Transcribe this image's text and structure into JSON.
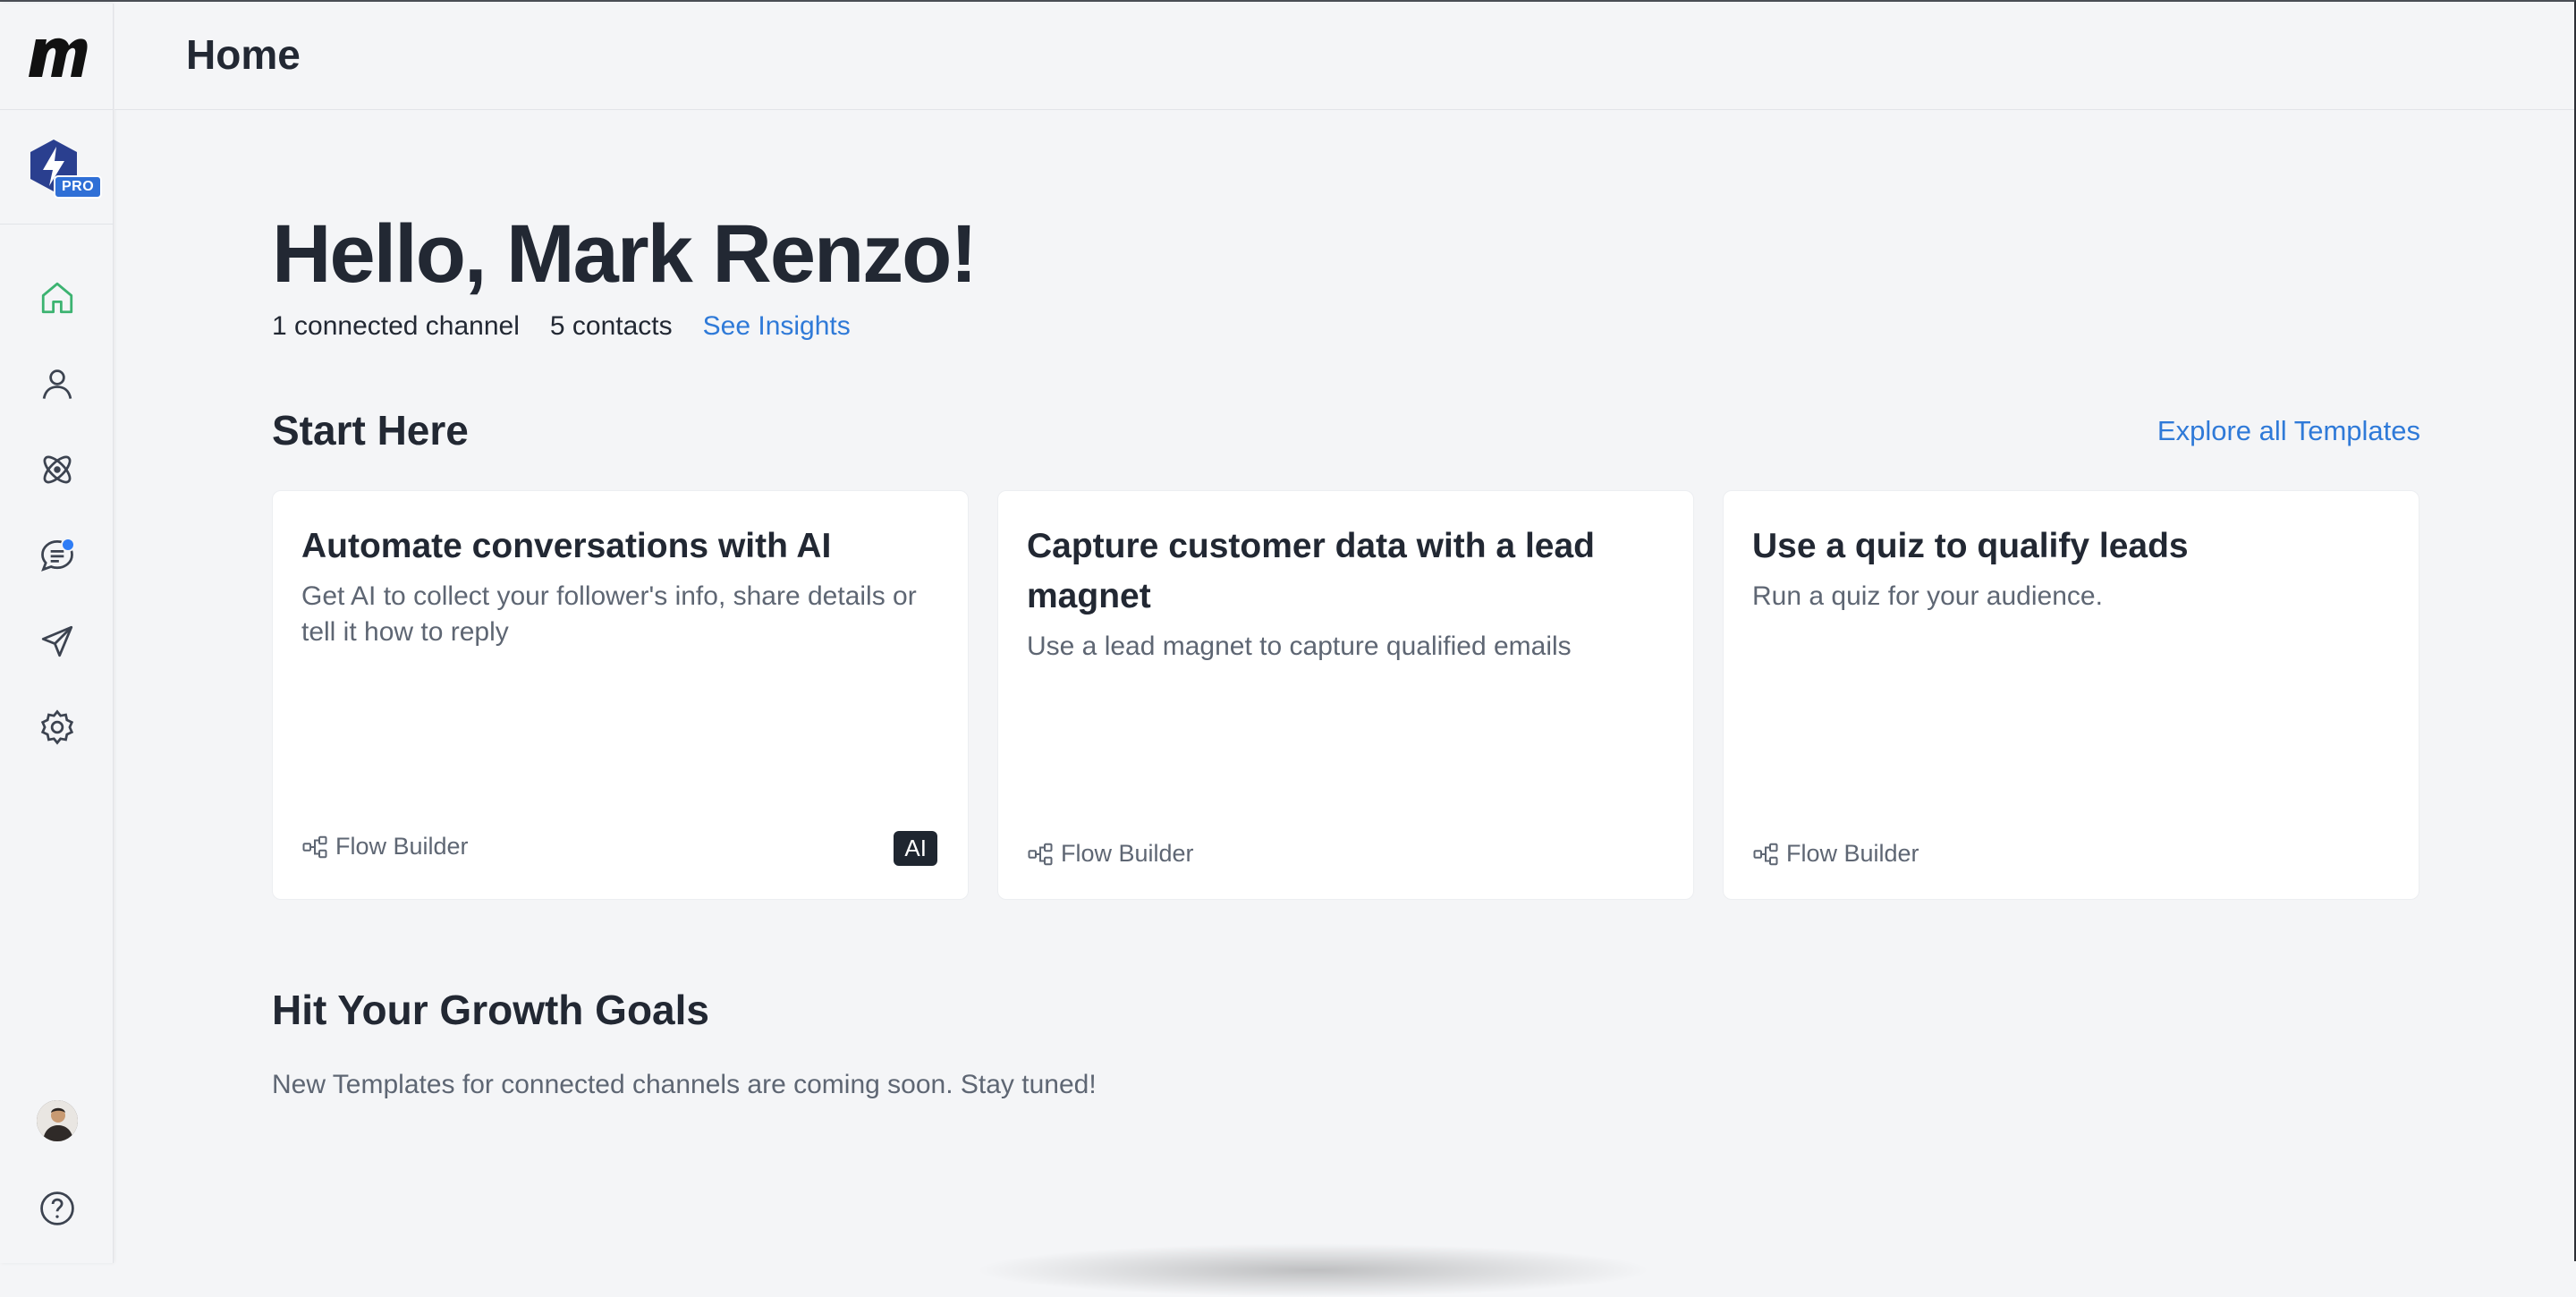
{
  "header": {
    "title": "Home"
  },
  "sidebar": {
    "logo": "manychat-logo",
    "pro_label": "PRO",
    "items": [
      {
        "name": "home",
        "icon": "home-icon",
        "active": true
      },
      {
        "name": "contacts",
        "icon": "user-icon"
      },
      {
        "name": "automation",
        "icon": "atom-icon"
      },
      {
        "name": "live-chat",
        "icon": "chat-icon",
        "notification": true
      },
      {
        "name": "broadcasting",
        "icon": "send-icon"
      },
      {
        "name": "settings",
        "icon": "gear-icon"
      }
    ],
    "bottom": [
      {
        "name": "avatar",
        "icon": "avatar"
      },
      {
        "name": "help",
        "icon": "help-icon"
      }
    ]
  },
  "main": {
    "greeting": "Hello, Mark Renzo!",
    "stats": {
      "channels": "1 connected channel",
      "contacts": "5 contacts",
      "insights_link": "See Insights"
    },
    "start_here": {
      "title": "Start Here",
      "explore_link": "Explore all Templates",
      "cards": [
        {
          "title": "Automate conversations with AI",
          "description": "Get AI to collect your follower's info, share details or tell it how to reply",
          "footer": "Flow Builder",
          "badge": "AI"
        },
        {
          "title": "Capture customer data with a lead magnet",
          "description": "Use a lead magnet to capture qualified emails",
          "footer": "Flow Builder"
        },
        {
          "title": "Use a quiz to qualify leads",
          "description": "Run a quiz for your audience.",
          "footer": "Flow Builder"
        }
      ]
    },
    "growth": {
      "title": "Hit Your Growth Goals",
      "message": "New Templates for connected channels are coming soon. Stay tuned!"
    }
  },
  "colors": {
    "accent": "#2f7ad8",
    "active_icon": "#3cb371",
    "text": "#222833",
    "muted": "#5e6673",
    "background": "#f4f5f7"
  }
}
